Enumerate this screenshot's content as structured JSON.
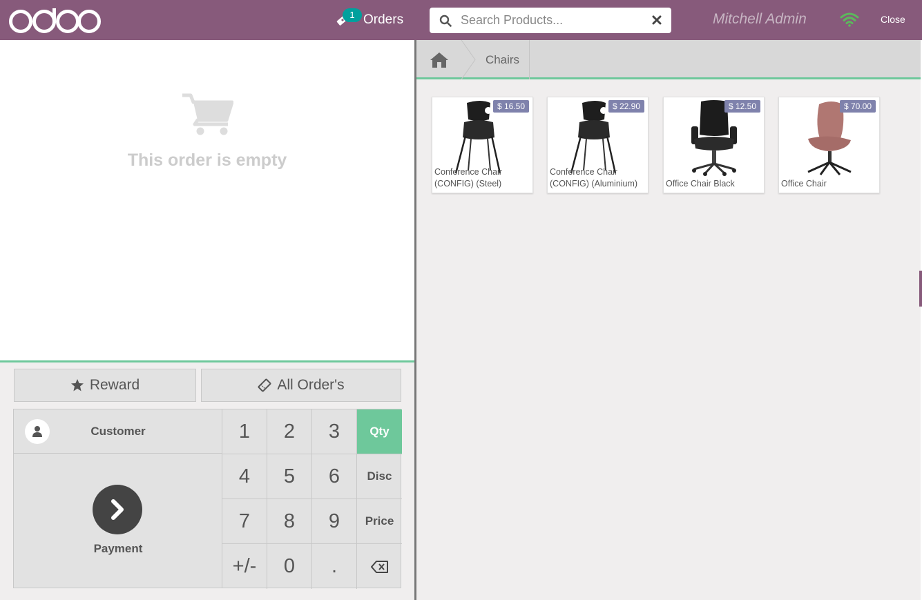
{
  "header": {
    "logo_text": "odoo",
    "orders_label": "Orders",
    "orders_count": "1",
    "search_placeholder": "Search Products...",
    "user_name": "Mitchell Admin",
    "close_label": "Close",
    "colors": {
      "bar": "#875a7b",
      "badge": "#00a09d",
      "wifi": "#5cb85c"
    }
  },
  "order": {
    "empty_message": "This order is empty"
  },
  "controls": {
    "reward_label": "Reward",
    "all_orders_label": "All Order's",
    "customer_label": "Customer",
    "payment_label": "Payment",
    "keys": [
      "1",
      "2",
      "3",
      "4",
      "5",
      "6",
      "7",
      "8",
      "9",
      "+/-",
      "0",
      "."
    ],
    "modes": [
      "Qty",
      "Disc",
      "Price"
    ],
    "active_mode": "Qty"
  },
  "breadcrumb": {
    "home_icon": "home-icon",
    "category": "Chairs"
  },
  "products": [
    {
      "name": "Conference Chair (CONFIG) (Steel)",
      "price": "$ 16.50",
      "image": "stacking-chair"
    },
    {
      "name": "Conference Chair (CONFIG) (Aluminium)",
      "price": "$ 22.90",
      "image": "stacking-chair"
    },
    {
      "name": "Office Chair Black",
      "price": "$ 12.50",
      "image": "office-chair-black"
    },
    {
      "name": "Office Chair",
      "price": "$ 70.00",
      "image": "office-chair-pink"
    }
  ]
}
